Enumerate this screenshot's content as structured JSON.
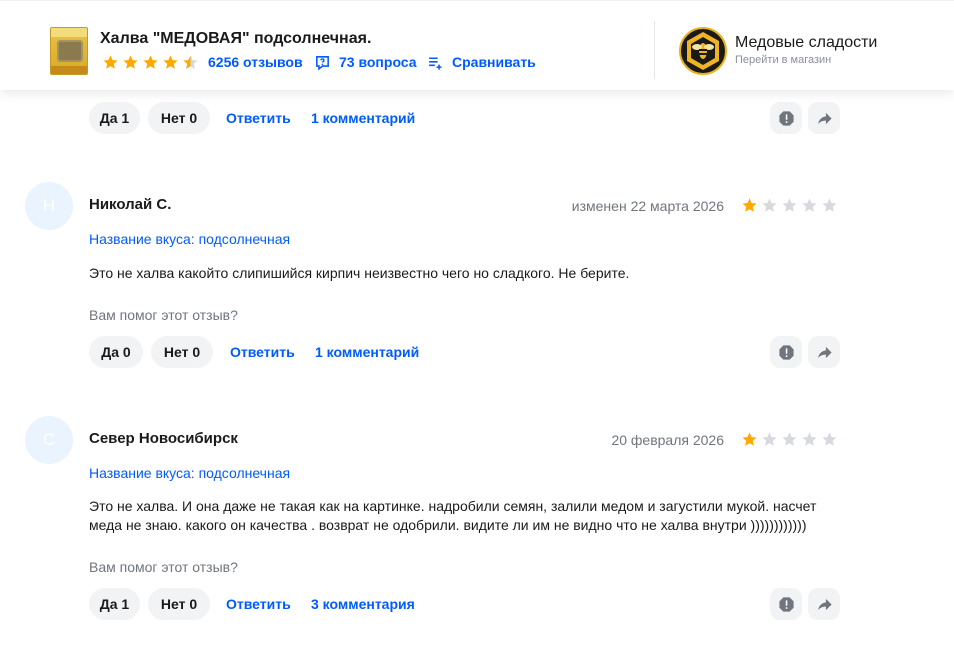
{
  "header": {
    "product_title": "Халва \"МЕДОВАЯ\" подсолнечная.",
    "rating_stars": 4.5,
    "reviews_count": "6256 отзывов",
    "questions_count": "73 вопроса",
    "compare_label": "Сравнивать",
    "shop_name": "Медовые сладости",
    "shop_link": "Перейти в магазин",
    "product_icon": "halva-package-thumbnail",
    "shop_icon": "honey-bee-logo"
  },
  "colors": {
    "accent": "#005bff",
    "star": "#ffa800",
    "star_empty": "#d6d9de"
  },
  "top_actions": {
    "yes_label": "Да 1",
    "no_label": "Нет 0",
    "reply_label": "Ответить",
    "comments_label": "1 комментарий"
  },
  "reviews": [
    {
      "avatar_letter": "Н",
      "author": "Николай С.",
      "date": "изменен 22 марта 2026",
      "rating": 1,
      "variant": "Название вкуса: подсолнечная",
      "text": "Это не халва какойто слипишийся кирпич неизвестно чего но сладкого. Не берите.",
      "helpful_question": "Вам помог этот отзыв?",
      "yes_label": "Да 0",
      "no_label": "Нет 0",
      "reply_label": "Ответить",
      "comments_label": "1 комментарий"
    },
    {
      "avatar_letter": "С",
      "author": "Север Новосибирск",
      "date": "20 февраля 2026",
      "rating": 1,
      "variant": "Название вкуса: подсолнечная",
      "text": "Это не халва. И она даже не такая как на картинке. надробили семян, залили медом и загустили мукой. насчет меда не знаю. какого он качества . возврат не одобрили. видите ли им не видно что не халва внутри ))))))))))))",
      "helpful_question": "Вам помог этот отзыв?",
      "yes_label": "Да 1",
      "no_label": "Нет 0",
      "reply_label": "Ответить",
      "comments_label": "3 комментария"
    }
  ],
  "icons": {
    "report": "report-icon",
    "share": "share-icon",
    "question": "question-icon",
    "compare": "compare-icon",
    "star": "star-icon"
  }
}
